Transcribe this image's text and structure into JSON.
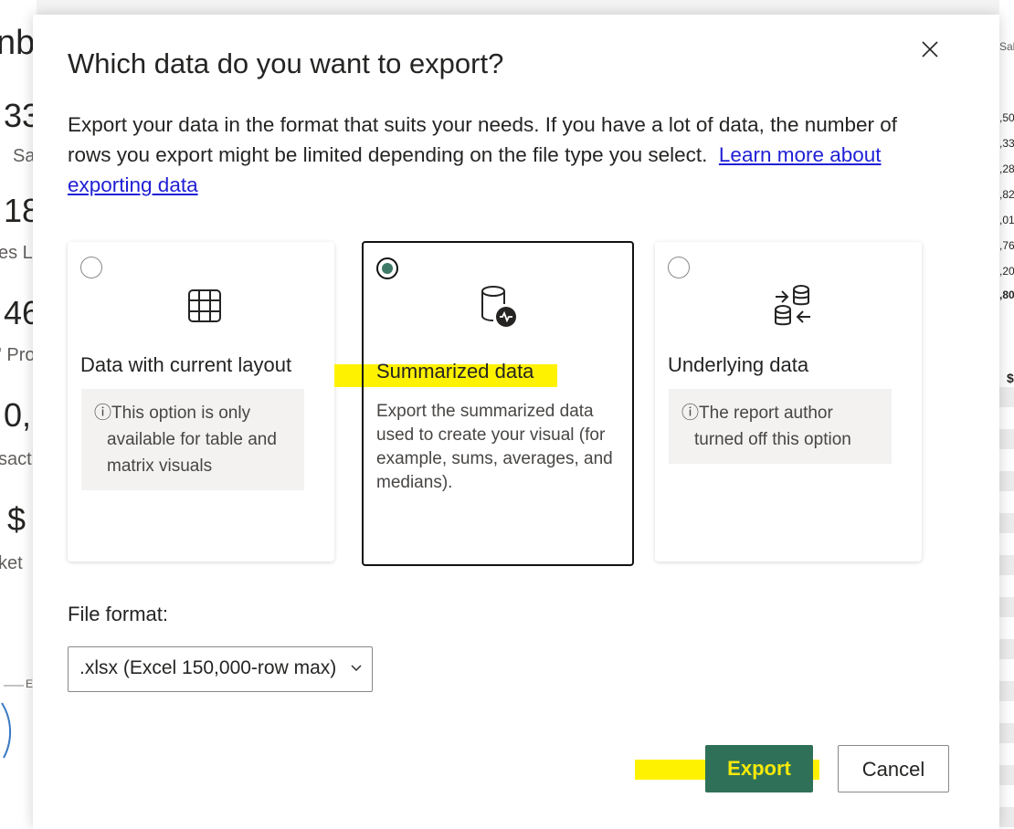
{
  "background": {
    "left_fragments": [
      "nbc",
      "33",
      "Sa",
      "18",
      "es L",
      "46",
      "' Pro",
      "0,",
      "sacti",
      "$",
      "ket",
      "E"
    ],
    "right_fragments": [
      "Sal",
      ",50",
      ",33",
      ",28",
      ",82",
      ",01",
      ",76",
      ",20",
      ",80",
      "$"
    ]
  },
  "dialog": {
    "title": "Which data do you want to export?",
    "description": "Export your data in the format that suits your needs. If you have a lot of data, the number of rows you export might be limited depending on the file type you select.",
    "learn_more_link": "Learn more about exporting data",
    "close_icon": "close-icon",
    "options": [
      {
        "title": "Data with current layout",
        "selected": false,
        "icon": "table-icon",
        "info_lines": [
          "This option is only",
          "available for table and",
          "matrix visuals"
        ]
      },
      {
        "title": "Summarized data",
        "selected": true,
        "icon": "database-activity-icon",
        "description": "Export the summarized data used to create your visual (for example, sums, averages, and medians)."
      },
      {
        "title": "Underlying data",
        "selected": false,
        "icon": "data-transfer-icon",
        "info_lines": [
          "The report author",
          "turned off this option"
        ]
      }
    ],
    "file_format": {
      "label": "File format:",
      "value": ".xlsx (Excel 150,000-row max)"
    },
    "buttons": {
      "export": "Export",
      "cancel": "Cancel"
    },
    "colors": {
      "primary_button": "#2e7158",
      "highlight": "#fff200",
      "radio_selected": "#3e7a68",
      "link": "#1f1fd6"
    }
  }
}
